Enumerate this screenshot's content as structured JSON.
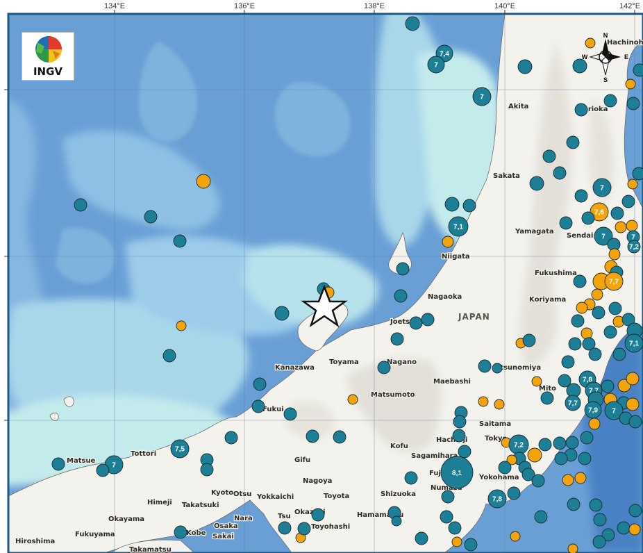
{
  "map": {
    "longitude_ticks": [
      "134°E",
      "136°E",
      "138°E",
      "140°E",
      "142°E"
    ],
    "country_label": "JAPAN",
    "cities": [
      "Hachinohe",
      "Akita",
      "Morioka",
      "Sakata",
      "Yamagata",
      "Sendai",
      "Fukushima",
      "Niigata",
      "Nagaoka",
      "Koriyama",
      "Joetsu",
      "Toyama",
      "Kanazawa",
      "Nagano",
      "Utsunomiya",
      "Maebashi",
      "Mito",
      "Matsumoto",
      "Fukui",
      "Saitama",
      "Tottori",
      "Matsue",
      "Kofu",
      "Hachioji",
      "Tokyo",
      "Sagamihara",
      "Gifu",
      "Nagoya",
      "Fuji",
      "Yokohama",
      "Kyoto",
      "Otsu",
      "Yokkaichi",
      "Toyota",
      "Numazu",
      "Himeji",
      "Takatsuki",
      "Shizuoka",
      "Okayama",
      "Nara",
      "Okazaki",
      "Hamamatsu",
      "Osaka",
      "Fukuyama",
      "Tsu",
      "Toyohashi",
      "Hiroshima",
      "Kobe",
      "Sakai",
      "Takamatsu"
    ],
    "compass": {
      "n": "N",
      "s": "S",
      "e": "E",
      "w": "W"
    },
    "magnitude_labels": [
      "7,4",
      "7",
      "7",
      "7",
      "7,6",
      "7",
      "7",
      "7,2",
      "7,1",
      "7,7",
      "7,1",
      "7,8",
      "7,7",
      "7,7",
      "7,9",
      "7",
      "7,2",
      "7,5",
      "8,1",
      "7,8"
    ]
  },
  "logo": {
    "text": "INGV"
  },
  "colors": {
    "deep_event": "#1c7f95",
    "shallow_event": "#f4a40b",
    "sea_deep": "#6a9fd6",
    "sea_mid": "#8fc0e4",
    "sea_shallow": "#c4ebec",
    "land": "#f3f2ed",
    "frame": "#1d5a85"
  }
}
